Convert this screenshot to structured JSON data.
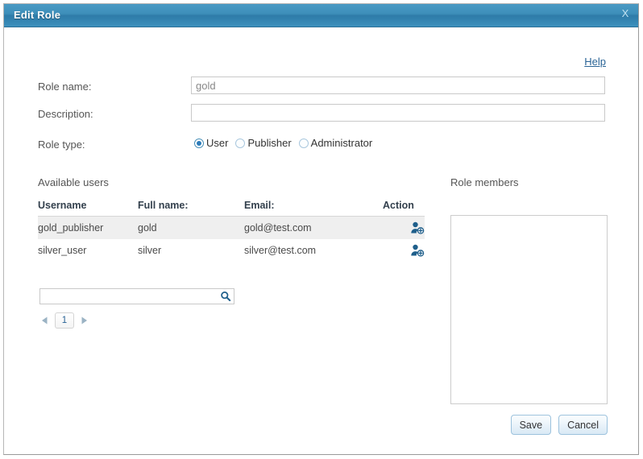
{
  "window": {
    "title": "Edit Role",
    "close_label": "X"
  },
  "help": {
    "label": "Help"
  },
  "form": {
    "role_name": {
      "label": "Role name:",
      "value": "gold",
      "placeholder": ""
    },
    "description": {
      "label": "Description:",
      "value": "",
      "placeholder": ""
    },
    "role_type": {
      "label": "Role type:",
      "options": [
        {
          "label": "User",
          "selected": true
        },
        {
          "label": "Publisher",
          "selected": false
        },
        {
          "label": "Administrator",
          "selected": false
        }
      ]
    }
  },
  "available_users": {
    "title": "Available users",
    "columns": [
      "Username",
      "Full name:",
      "Email:",
      "Action"
    ],
    "rows": [
      {
        "username": "gold_publisher",
        "fullname": "gold",
        "email": "gold@test.com",
        "action_icon": "add-user-icon"
      },
      {
        "username": "silver_user",
        "fullname": "silver",
        "email": "silver@test.com",
        "action_icon": "add-user-icon"
      }
    ],
    "search": {
      "value": "",
      "placeholder": "",
      "icon": "search-icon"
    },
    "pagination": {
      "prev_icon": "triangle-left-icon",
      "next_icon": "triangle-right-icon",
      "current_page": "1"
    }
  },
  "role_members": {
    "title": "Role members",
    "items": []
  },
  "buttons": {
    "save": "Save",
    "cancel": "Cancel"
  },
  "colors": {
    "titlebar": "#3e8fba",
    "accent": "#2a6496",
    "icon_blue": "#1f5f8b",
    "row_highlight": "#efefef"
  }
}
